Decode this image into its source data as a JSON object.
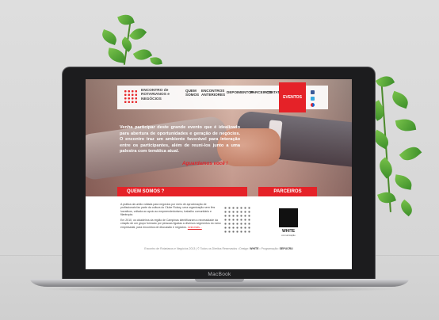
{
  "device": {
    "brand": "MacBook"
  },
  "site": {
    "logo_text": "ENCONTRO de ROTARIANOS e NEGÓCIOS",
    "nav": [
      "QUEM SOMOS",
      "ENCONTROS ANTERIORES",
      "DEPOIMENTOS",
      "PARCEIROS",
      "CONTATO"
    ],
    "nav_cta": "EVENTOS",
    "social_icons": [
      "facebook-icon",
      "twitter-icon",
      "flickr-icon"
    ],
    "colors": {
      "accent": "#e52228",
      "text": "#444444"
    },
    "intro": "Venha participar deste grande evento que é idealizado para abertura de oportunidades e geração de negócios. O encontro traz um ambiente favorável para interação entre os participantes, além de reuni-los junto a uma palestra com temática atual.",
    "intro_cta": "Aguardamos você !",
    "about_title": "QUEM SOMOS ?",
    "about_p1": "A prática da união voltada para negócios por meio de aproximação de profissionais faz parte da cultura do Clube Rotary, uma organização sem fins lucrativos, voltada ao apoio ao empreendedorismo, trabalho comunitário e filantropia.",
    "about_p2": "Em 2010, os cidadeiros da região de Campinas identificaram a necessidade da criação de um grupo formado por pessoas ligadas a diversos segmentos do ramo empresarial, para encontros de discussão e negócios.",
    "about_more": "Leia mais...",
    "partners_title": "PARCEIROS",
    "partner_name": "WHITE",
    "partner_sub": "comunicação",
    "footer_text": "Encontro de Rotarianos e Negócios 2013 | © Todos os Direitos Reservados • Design:",
    "footer_design": "WHITE",
    "footer_prog_label": "• Programação:",
    "footer_prog": "SEPUCRU"
  }
}
